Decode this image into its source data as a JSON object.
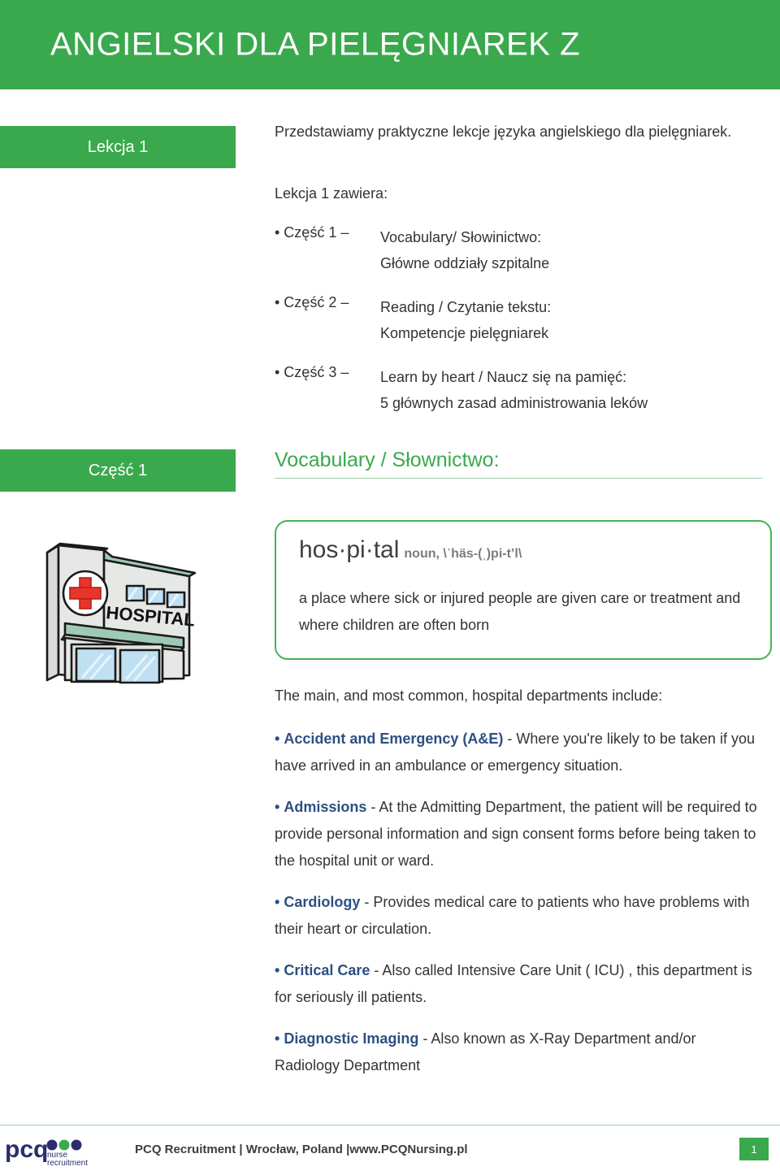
{
  "header": {
    "title": "ANGIELSKI DLA PIELĘGNIAREK Z",
    "banner_color": "#3aa94d"
  },
  "lesson": {
    "chip_label": "Lekcja 1",
    "intro": "Przedstawiamy praktyczne lekcje języka angielskiego dla pielęgniarek.",
    "contains_label": "Lekcja 1 zawiera:",
    "parts": [
      {
        "label": "• Część 1 –",
        "line1": "Vocabulary/ Słowinictwo:",
        "line2": "Główne oddziały szpitalne"
      },
      {
        "label": "• Część 2 –",
        "line1": "Reading / Czytanie tekstu:",
        "line2": "Kompetencje pielęgniarek"
      },
      {
        "label": "• Część 3 –",
        "line1": "Learn by heart / Naucz się na pamięć:",
        "line2": "5 głównych zasad administrowania leków"
      }
    ]
  },
  "section": {
    "chip_label": "Część 1",
    "heading": "Vocabulary / Słownictwo:",
    "heading_color": "#3aa94d"
  },
  "illustration": {
    "name": "hospital-building-illustration",
    "sign_text": "HOSPITAL",
    "cross_color": "#e8342c",
    "awning_color": "#9ec9b6"
  },
  "definition": {
    "word": "hos·pi·tal",
    "part_of_speech": "noun,",
    "phonetic": "\\ˈhäs-(ˌ)pi-t’l\\",
    "meaning": "a place where sick or injured people are given care or treatment and where children are often born",
    "border_color": "#48b257"
  },
  "departments": {
    "intro": "The main, and most common, hospital departments include:",
    "term_color": "#2d4f82",
    "items": [
      {
        "bullet": "•",
        "term": "Accident and Emergency (A&E)",
        "text": " - Where you're likely to be taken if you have arrived in an ambulance or emergency situation."
      },
      {
        "bullet": "•",
        "term": "Admissions",
        "text": " - At the Admitting Department, the patient will be required to provide personal information and sign consent forms before being taken to the hospital unit or ward."
      },
      {
        "bullet": "•",
        "term": "Cardiology",
        "text": " - Provides medical care to patients who have problems with their heart or circulation."
      },
      {
        "bullet": "•",
        "term": "Critical Care",
        "text": " - Also called Intensive Care Unit ( ICU) , this department is for seriously ill patients."
      },
      {
        "bullet": "•",
        "term": "Diagnostic Imaging",
        "text": " - Also known as X-Ray Department and/or Radiology Department"
      }
    ]
  },
  "footer": {
    "logo_mark": "pcq",
    "logo_line1": "nurse",
    "logo_line2": "recruitment",
    "logo_navy": "#2b2d6e",
    "logo_green": "#3aa94d",
    "text": "PCQ Recruitment | Wrocław, Poland |www.PCQNursing.pl",
    "page_number": "1"
  }
}
